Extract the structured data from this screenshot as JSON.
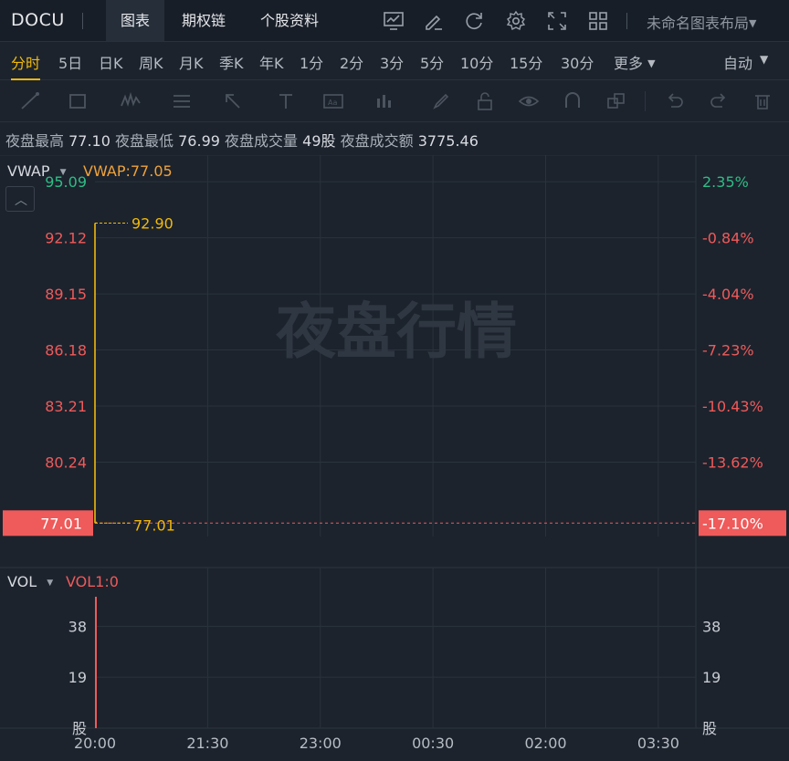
{
  "topbar": {
    "ticker": "DOCU",
    "tabs": [
      {
        "label": "图表",
        "active": true
      },
      {
        "label": "期权链",
        "active": false
      },
      {
        "label": "个股资料",
        "active": false
      }
    ],
    "layout_name": "未命名图表布局"
  },
  "periods": {
    "items": [
      "分时",
      "5日",
      "日K",
      "周K",
      "月K",
      "季K",
      "年K",
      "1分",
      "2分",
      "3分",
      "5分",
      "10分",
      "15分",
      "30分",
      "更多"
    ],
    "active": "分时",
    "auto_label": "自动"
  },
  "info": {
    "high_label": "夜盘最高",
    "high_value": "77.10",
    "low_label": "夜盘最低",
    "low_value": "76.99",
    "vol_label": "夜盘成交量",
    "vol_value": "49股",
    "amt_label": "夜盘成交额",
    "amt_value": "3775.46"
  },
  "watermark": "夜盘行情",
  "indicators": {
    "main_name": "VWAP",
    "main_value": "VWAP:77.05",
    "sub_name": "VOL",
    "sub_value": "VOL1:0"
  },
  "colors": {
    "up": "#2ebd85",
    "down": "#ef5a5a",
    "accent": "#f0b90b",
    "vwap": "#f0a23a"
  },
  "chart_data": {
    "type": "line",
    "price_ticks": [
      "95.09",
      "92.12",
      "89.15",
      "86.18",
      "83.21",
      "80.24"
    ],
    "pct_ticks": [
      "2.35%",
      "-0.84%",
      "-4.04%",
      "-7.23%",
      "-10.43%",
      "-13.62%"
    ],
    "ylim": [
      76.3,
      96.5
    ],
    "current_price": "77.01",
    "current_pct": "-17.10%",
    "max_marker": "92.90",
    "min_marker": "77.01",
    "series": [
      {
        "values": [
          {
            "x": "20:00",
            "y": 92.9
          },
          {
            "x": "20:00",
            "y": 77.01
          }
        ]
      }
    ],
    "vwap": 77.05,
    "volume": {
      "ticks": [
        "38",
        "19",
        "股"
      ],
      "unit": "股",
      "ylim": [
        0,
        49
      ],
      "bars": [
        {
          "x": "20:00",
          "y": 49
        }
      ]
    },
    "x_ticks": [
      "20:00",
      "21:30",
      "23:00",
      "00:30",
      "02:00",
      "03:30"
    ]
  }
}
